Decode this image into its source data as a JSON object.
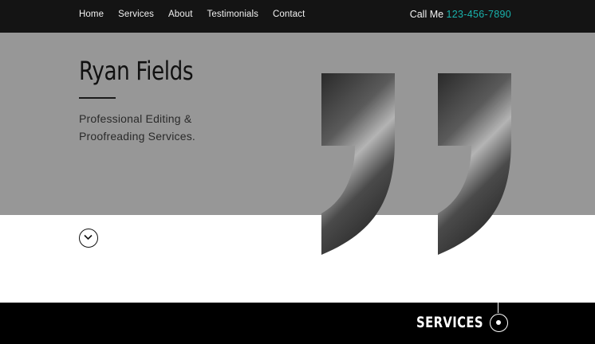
{
  "nav": {
    "items": [
      {
        "label": "Home"
      },
      {
        "label": "Services"
      },
      {
        "label": "About"
      },
      {
        "label": "Testimonials"
      },
      {
        "label": "Contact"
      }
    ]
  },
  "contact": {
    "prefix": "Call Me",
    "phone": "123-456-7890",
    "phone_color": "#19b3ad"
  },
  "hero": {
    "title": "Ryan Fields",
    "tagline_line1": "Professional Editing &",
    "tagline_line2": "Proofreading Services.",
    "background": "#979797"
  },
  "icons": {
    "scroll": "chevron-down-circle-icon",
    "quote": "closing-quote-mark-icon",
    "section_marker": "dot-circle-icon"
  },
  "services_section": {
    "label": "SERVICES"
  }
}
